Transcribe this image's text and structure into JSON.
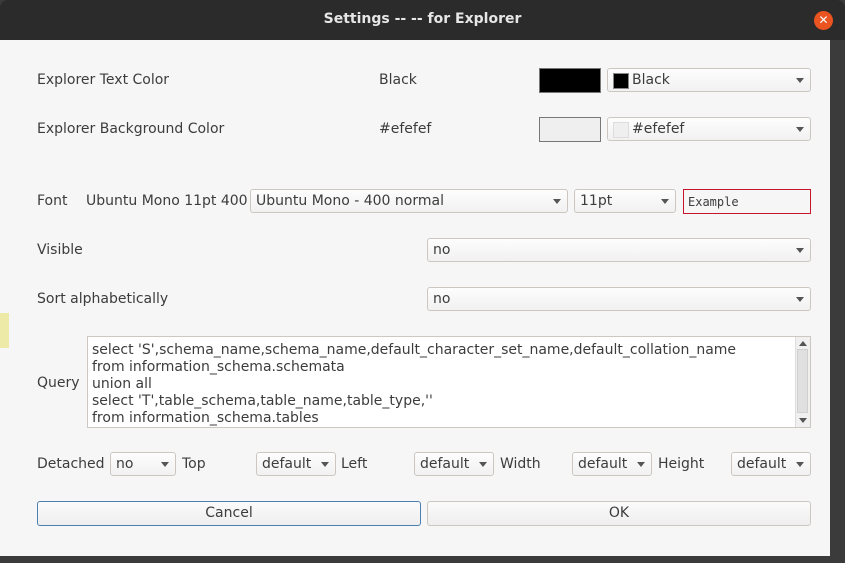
{
  "window": {
    "title": "Settings -- -- for Explorer",
    "close_icon": "close-icon"
  },
  "text_color": {
    "label": "Explorer Text Color",
    "value": "Black",
    "swatch": "#000000",
    "combo": "Black"
  },
  "bg_color": {
    "label": "Explorer Background Color",
    "value": "#efefef",
    "swatch": "#efefef",
    "combo": "#efefef"
  },
  "font": {
    "label": "Font",
    "current": "Ubuntu Mono 11pt 400",
    "family": "Ubuntu Mono - 400 normal",
    "size": "11pt",
    "example": "Example"
  },
  "visible": {
    "label": "Visible",
    "value": "no"
  },
  "sort": {
    "label": "Sort alphabetically",
    "value": "no"
  },
  "query": {
    "label": "Query",
    "lines": [
      "select 'S',schema_name,schema_name,default_character_set_name,default_collation_name",
      "from information_schema.schemata",
      "union all",
      "select 'T',table_schema,table_name,table_type,''",
      "from information_schema.tables"
    ]
  },
  "geometry": {
    "detached_label": "Detached",
    "detached": "no",
    "top_label": "Top",
    "top": "default",
    "left_label": "Left",
    "left": "default",
    "width_label": "Width",
    "width": "default",
    "height_label": "Height",
    "height": "default"
  },
  "buttons": {
    "cancel": "Cancel",
    "ok": "OK"
  }
}
